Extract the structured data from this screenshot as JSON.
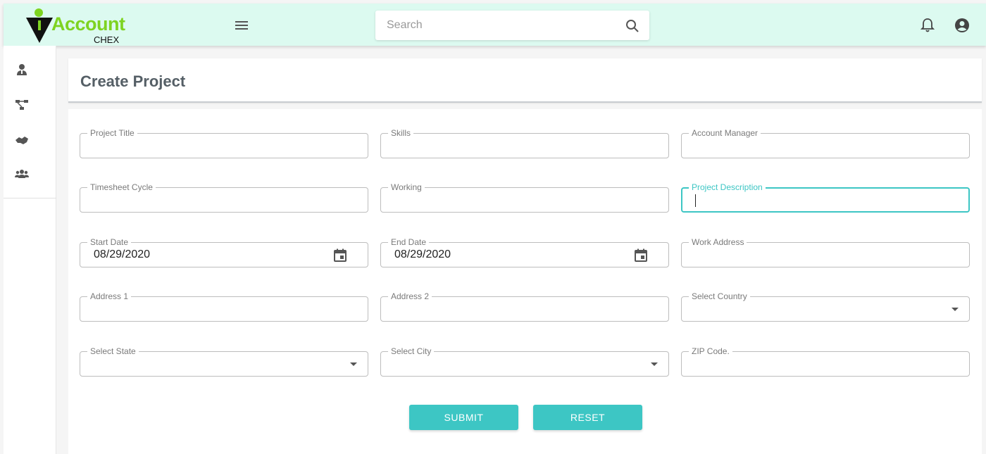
{
  "app": {
    "logo_text": "Account",
    "logo_subtext": "CHEX"
  },
  "search": {
    "placeholder": "Search"
  },
  "icons": {
    "menu": "hamburger-menu-icon",
    "search": "search-icon",
    "notifications": "bell-icon",
    "account": "account-circle-icon"
  },
  "sidebar": {
    "items": [
      {
        "name": "user-tie-icon"
      },
      {
        "name": "sitemap-icon"
      },
      {
        "name": "handshake-icon"
      },
      {
        "name": "users-icon"
      }
    ]
  },
  "page": {
    "title": "Create Project"
  },
  "form": {
    "project_title": {
      "label": "Project Title",
      "value": ""
    },
    "skills": {
      "label": "Skills",
      "value": ""
    },
    "account_manager": {
      "label": "Account Manager",
      "value": ""
    },
    "timesheet_cycle": {
      "label": "Timesheet Cycle",
      "value": ""
    },
    "working": {
      "label": "Working",
      "value": ""
    },
    "project_description": {
      "label": "Project Description",
      "value": ""
    },
    "start_date": {
      "label": "Start Date",
      "value": "08/29/2020"
    },
    "end_date": {
      "label": "End Date",
      "value": "08/29/2020"
    },
    "work_address": {
      "label": "Work Address",
      "value": ""
    },
    "address1": {
      "label": "Address 1",
      "value": ""
    },
    "address2": {
      "label": "Address 2",
      "value": ""
    },
    "country": {
      "label": "Select Country",
      "value": ""
    },
    "state": {
      "label": "Select State",
      "value": ""
    },
    "city": {
      "label": "Select City",
      "value": ""
    },
    "zip": {
      "label": "ZIP Code.",
      "value": ""
    }
  },
  "buttons": {
    "submit": "SUBMIT",
    "reset": "RESET"
  },
  "colors": {
    "accent": "#3dc6c4",
    "topbar": "#dcfaf0",
    "logo_green": "#7ed321"
  }
}
